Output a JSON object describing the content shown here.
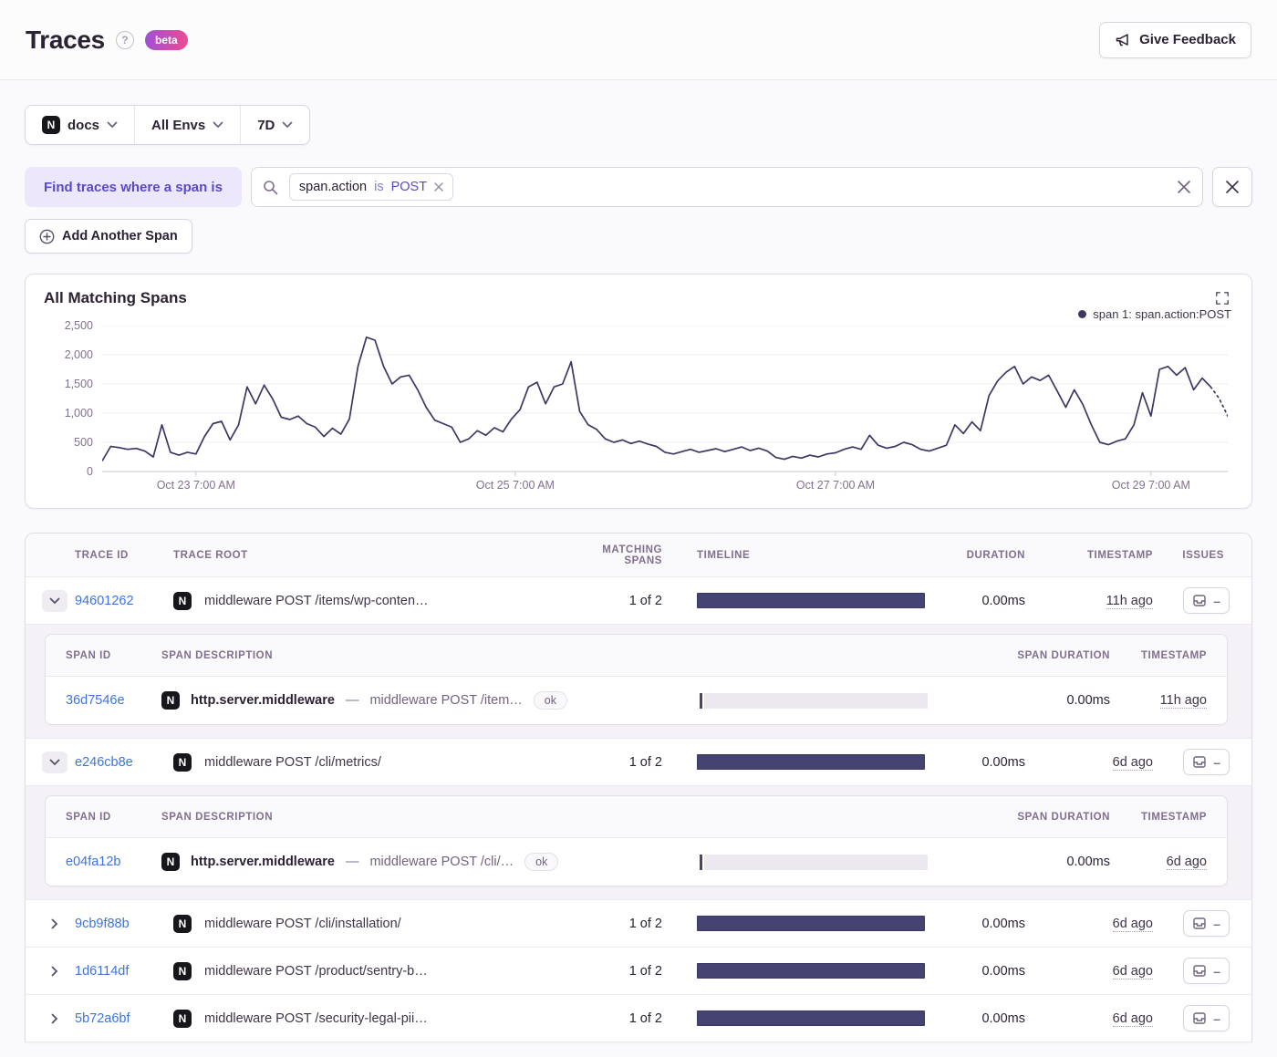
{
  "header": {
    "title": "Traces",
    "beta": "beta",
    "feedback": "Give Feedback"
  },
  "filters": {
    "project": "docs",
    "env": "All Envs",
    "period": "7D"
  },
  "query": {
    "where_label": "Find traces where a span is",
    "chip": {
      "key": "span.action",
      "op": "is",
      "value": "POST"
    },
    "add_span": "Add Another Span"
  },
  "chart_data": {
    "type": "line",
    "title": "All Matching Spans",
    "series": [
      {
        "name": "span 1: span.action:POST",
        "values": [
          180,
          430,
          410,
          380,
          395,
          350,
          250,
          800,
          330,
          280,
          330,
          300,
          600,
          820,
          860,
          540,
          800,
          1450,
          1160,
          1480,
          1240,
          930,
          890,
          950,
          820,
          760,
          600,
          740,
          640,
          900,
          1800,
          2300,
          2250,
          1800,
          1500,
          1620,
          1650,
          1400,
          1100,
          880,
          820,
          760,
          500,
          560,
          700,
          620,
          750,
          680,
          900,
          1060,
          1450,
          1530,
          1160,
          1450,
          1500,
          1880,
          1030,
          800,
          720,
          560,
          500,
          540,
          480,
          520,
          470,
          430,
          330,
          300,
          340,
          380,
          330,
          360,
          390,
          340,
          380,
          420,
          360,
          400,
          350,
          240,
          210,
          260,
          230,
          280,
          250,
          300,
          320,
          380,
          420,
          380,
          620,
          450,
          400,
          430,
          500,
          460,
          380,
          350,
          400,
          450,
          800,
          650,
          850,
          700,
          1300,
          1550,
          1700,
          1800,
          1500,
          1620,
          1560,
          1650,
          1380,
          1100,
          1400,
          1150,
          800,
          500,
          460,
          520,
          560,
          800,
          1350,
          950,
          1750,
          1800,
          1650,
          1780,
          1400,
          1600,
          1450,
          1250,
          950
        ]
      }
    ],
    "xlabel": "",
    "ylabel": "",
    "ylim": [
      0,
      2500
    ],
    "yticks": [
      {
        "value": 0,
        "label": "0"
      },
      {
        "value": 500,
        "label": "500"
      },
      {
        "value": 1000,
        "label": "1,000"
      },
      {
        "value": 1500,
        "label": "1,500"
      },
      {
        "value": 2000,
        "label": "2,000"
      },
      {
        "value": 2500,
        "label": "2,500"
      }
    ],
    "xticks": [
      {
        "frac": 0.0833,
        "label": "Oct 23 7:00 AM"
      },
      {
        "frac": 0.367,
        "label": "Oct 25 7:00 AM"
      },
      {
        "frac": 0.6515,
        "label": "Oct 27 7:00 AM"
      },
      {
        "frac": 0.9318,
        "label": "Oct 29 7:00 AM"
      }
    ],
    "dashed_tail_points": 2,
    "grid": true,
    "legend_position": "top-right"
  },
  "table": {
    "columns": [
      "TRACE ID",
      "TRACE ROOT",
      "MATCHING SPANS",
      "TIMELINE",
      "DURATION",
      "TIMESTAMP",
      "ISSUES"
    ],
    "span_columns": [
      "SPAN ID",
      "SPAN DESCRIPTION",
      "SPAN DURATION",
      "TIMESTAMP"
    ],
    "span_sep": "—",
    "issues_empty": "–",
    "rows": [
      {
        "trace_id": "94601262",
        "root": "middleware POST /items/wp-conten…",
        "matching": "1 of 2",
        "duration": "0.00ms",
        "timestamp": "11h ago",
        "spans": [
          {
            "span_id": "36d7546e",
            "op": "http.server.middleware",
            "desc": "middleware POST /item…",
            "status": "ok",
            "duration": "0.00ms",
            "timestamp": "11h ago"
          }
        ]
      },
      {
        "trace_id": "e246cb8e",
        "root": "middleware POST /cli/metrics/",
        "matching": "1 of 2",
        "duration": "0.00ms",
        "timestamp": "6d ago",
        "spans": [
          {
            "span_id": "e04fa12b",
            "op": "http.server.middleware",
            "desc": "middleware POST /cli/…",
            "status": "ok",
            "duration": "0.00ms",
            "timestamp": "6d ago"
          }
        ]
      },
      {
        "trace_id": "9cb9f88b",
        "root": "middleware POST /cli/installation/",
        "matching": "1 of 2",
        "duration": "0.00ms",
        "timestamp": "6d ago",
        "spans": []
      },
      {
        "trace_id": "1d6114df",
        "root": "middleware POST /product/sentry-b…",
        "matching": "1 of 2",
        "duration": "0.00ms",
        "timestamp": "6d ago",
        "spans": []
      },
      {
        "trace_id": "5b72a6bf",
        "root": "middleware POST /security-legal-pii…",
        "matching": "1 of 2",
        "duration": "0.00ms",
        "timestamp": "6d ago",
        "spans": []
      }
    ]
  },
  "colors": {
    "accent-purple": "#584AC6",
    "link-blue": "#3D74DB",
    "chart-line": "#3B3864",
    "timeline-bar": "#454371",
    "beta-from": "#9E50D8",
    "beta-to": "#EF4B8F"
  }
}
